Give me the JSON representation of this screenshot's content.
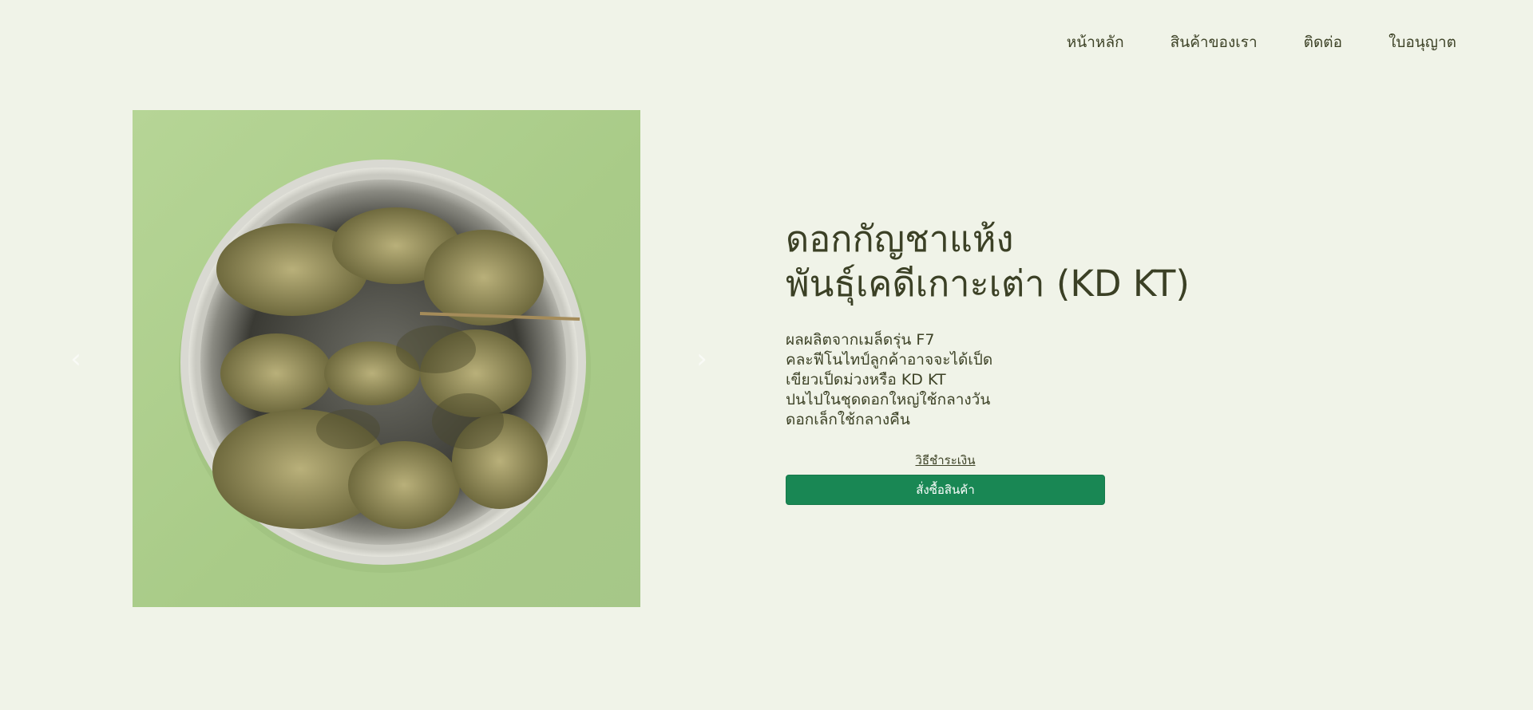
{
  "nav": {
    "items": [
      {
        "label": "หน้าหลัก"
      },
      {
        "label": "สินค้าของเรา"
      },
      {
        "label": "ติดต่อ"
      },
      {
        "label": "ใบอนุญาต"
      }
    ]
  },
  "carousel": {
    "image_alt_icon": "product-photo",
    "prev_icon": "chevron-left-icon",
    "next_icon": "chevron-right-icon"
  },
  "product": {
    "title_line1": "ดอกกัญชาแห้ง",
    "title_line2": "พันธุ์เคดีเกาะเต่า (KD KT)",
    "description": [
      "ผลผลิตจากเมล็ดรุ่น F7",
      "คละฟีโนไทป์ลูกค้าอาจจะได้เป็ด",
      "เขียวเป็ดม่วงหรือ KD KT",
      "ปนไปในชุดดอกใหญ่ใช้กลางวัน",
      "ดอกเล็กใช้กลางคืน"
    ],
    "payment_link": "วิธีชำระเงิน",
    "order_button": "สั่งซื้อสินค้า"
  },
  "colors": {
    "background": "#f0f3e8",
    "text": "#3d4226",
    "accent": "#198754"
  }
}
